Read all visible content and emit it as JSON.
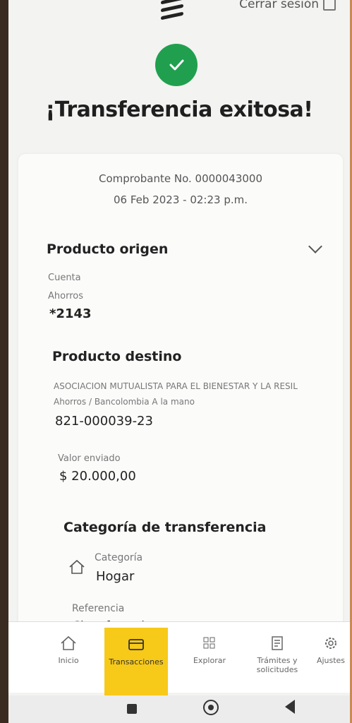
{
  "header": {
    "logout_label": "Cerrar sesión",
    "menu_icon": "bancolombia-logo-icon",
    "logout_icon": "logout-icon"
  },
  "status": {
    "icon": "check-icon",
    "title": "¡Transferencia exitosa!"
  },
  "receipt": {
    "voucher": "Comprobante No. 0000043000",
    "datetime": "06 Feb 2023 - 02:23 p.m."
  },
  "origin": {
    "title": "Producto origen",
    "type_label": "Cuenta",
    "subtype_label": "Ahorros",
    "account": "*2143"
  },
  "destination": {
    "title": "Producto destino",
    "name": "ASOCIACION MUTUALISTA PARA EL BIENESTAR Y LA RESIL",
    "type": "Ahorros / Bancolombia A la mano",
    "account": "821-000039-23",
    "amount_label": "Valor enviado",
    "amount": "$ 20.000,00"
  },
  "category": {
    "title": "Categoría de transferencia",
    "label": "Categoría",
    "value": "Hogar",
    "icon": "home-icon",
    "reference_label": "Referencia",
    "reference_value": "Sin referencia"
  },
  "nav": {
    "items": [
      {
        "label": "Inicio",
        "icon": "home-icon"
      },
      {
        "label": "Transacciones",
        "icon": "transactions-icon"
      },
      {
        "label": "Explorar",
        "icon": "grid-icon"
      },
      {
        "label": "Trámites y solicitudes",
        "icon": "documents-icon"
      },
      {
        "label": "Ajustes",
        "icon": "settings-icon"
      }
    ]
  },
  "colors": {
    "success": "#20a04f",
    "active_nav": "#f7c919"
  }
}
